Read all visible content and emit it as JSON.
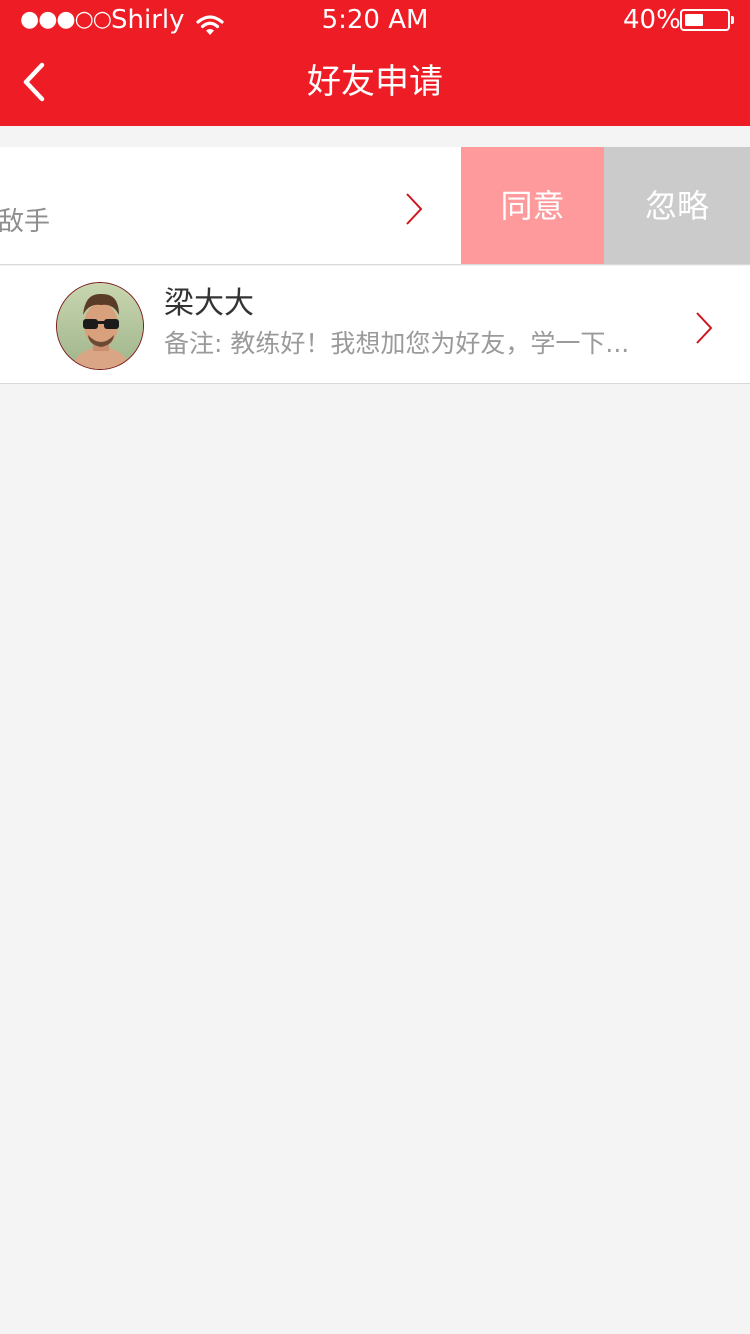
{
  "status_bar": {
    "signal": "●●●○○",
    "carrier": "Shirly",
    "time": "5:20 AM",
    "battery_percent": "40%",
    "battery_level": 0.4
  },
  "header": {
    "title": "好友申请",
    "back_icon": "chevron-left-icon"
  },
  "requests": [
    {
      "remark_partial": "敌手",
      "actions": {
        "agree": "同意",
        "ignore": "忽略"
      }
    },
    {
      "name": "梁大大",
      "remark": "备注: 教练好！我想加您为好友，学一下..."
    }
  ],
  "colors": {
    "header_bg": "#ee1c25",
    "agree_bg": "#fe9a9c",
    "ignore_bg": "#cbcbcb",
    "chevron": "#d0141c",
    "page_bg": "#f4f4f4"
  }
}
